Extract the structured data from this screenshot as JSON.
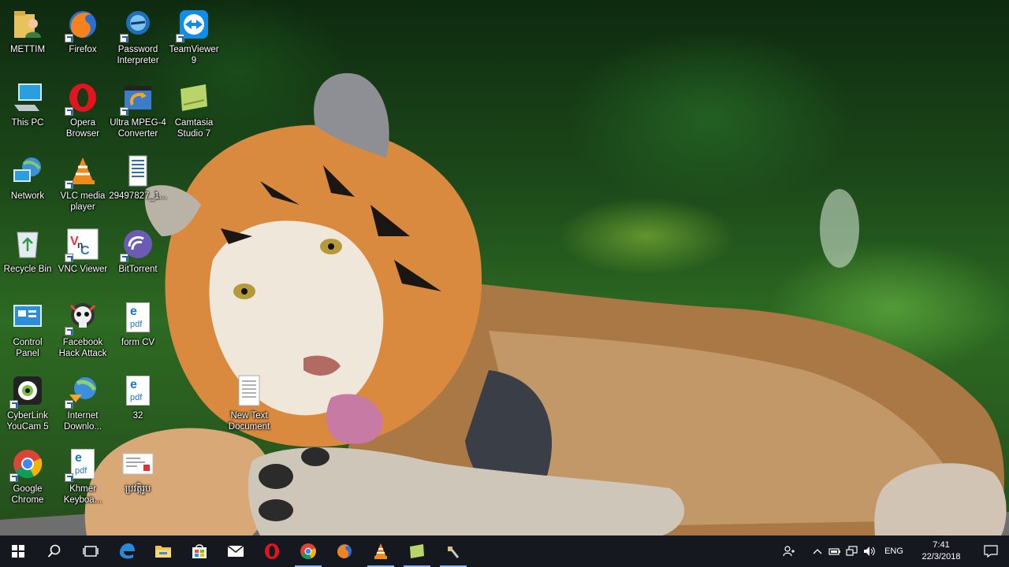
{
  "desktop": {
    "icons": [
      {
        "label": "METTIM",
        "icon": "user-folder-icon"
      },
      {
        "label": "This PC",
        "icon": "computer-icon"
      },
      {
        "label": "Network",
        "icon": "network-icon"
      },
      {
        "label": "Recycle Bin",
        "icon": "recycle-bin-icon"
      },
      {
        "label": "Control\nPanel",
        "icon": "control-panel-icon"
      },
      {
        "label": "CyberLink\nYouCam 5",
        "icon": "webcam-icon"
      },
      {
        "label": "Google\nChrome",
        "icon": "chrome-icon"
      },
      {
        "label": "Firefox",
        "icon": "firefox-icon"
      },
      {
        "label": "Opera\nBrowser",
        "icon": "opera-icon"
      },
      {
        "label": "VLC media\nplayer",
        "icon": "vlc-icon"
      },
      {
        "label": "VNC Viewer",
        "icon": "vnc-icon"
      },
      {
        "label": "Facebook\nHack Attack",
        "icon": "skull-icon"
      },
      {
        "label": "Internet\nDownlo...",
        "icon": "internet-download-icon"
      },
      {
        "label": "Khmer\nKeyboa...",
        "icon": "pdf-icon"
      },
      {
        "label": "Password\nInterpreter",
        "icon": "password-icon"
      },
      {
        "label": "Ultra MPEG-4\nConverter",
        "icon": "video-converter-icon"
      },
      {
        "label": "29497827_1...",
        "icon": "document-icon"
      },
      {
        "label": "BitTorrent",
        "icon": "bittorrent-icon"
      },
      {
        "label": "form CV",
        "icon": "pdf-icon"
      },
      {
        "label": "32",
        "icon": "pdf-icon"
      },
      {
        "label": "ប្រវត្តិរូប",
        "icon": "letter-icon"
      },
      {
        "label": "TeamViewer\n9",
        "icon": "teamviewer-icon"
      },
      {
        "label": "Camtasia\nStudio 7",
        "icon": "camtasia-icon"
      },
      {
        "label": "New Text\nDocument",
        "icon": "text-document-icon"
      }
    ]
  },
  "taskbar": {
    "pinned": [
      {
        "name": "start",
        "icon": "windows-start-icon"
      },
      {
        "name": "search",
        "icon": "search-icon"
      },
      {
        "name": "task-view",
        "icon": "task-view-icon"
      },
      {
        "name": "edge",
        "icon": "edge-icon"
      },
      {
        "name": "file-explorer",
        "icon": "folder-icon"
      },
      {
        "name": "store",
        "icon": "store-icon"
      },
      {
        "name": "mail",
        "icon": "mail-icon"
      },
      {
        "name": "opera",
        "icon": "opera-icon"
      },
      {
        "name": "chrome",
        "icon": "chrome-icon"
      },
      {
        "name": "firefox",
        "icon": "firefox-icon"
      },
      {
        "name": "vlc",
        "icon": "vlc-icon"
      },
      {
        "name": "camtasia",
        "icon": "camtasia-icon"
      },
      {
        "name": "app",
        "icon": "generic-app-icon"
      }
    ],
    "tray": {
      "language": "ENG",
      "time": "7:41",
      "date": "22/3/2018"
    }
  },
  "colors": {
    "taskbar_bg": "#15181f",
    "accent": "#8ab4f8"
  }
}
